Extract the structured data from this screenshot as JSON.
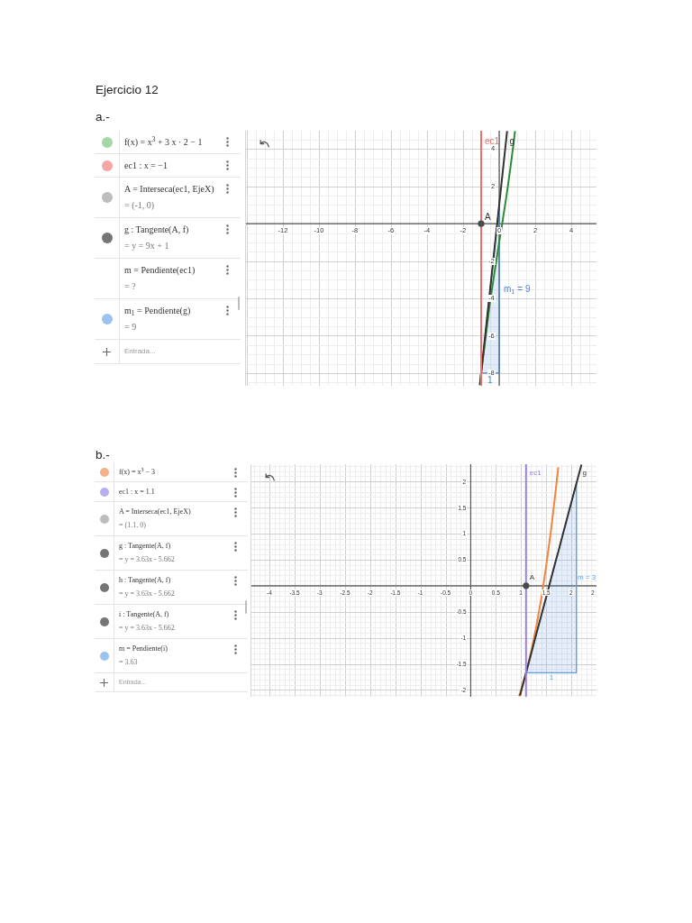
{
  "title": "Ejercicio 12",
  "parts": [
    {
      "label": "a.-",
      "algebra": {
        "rows": [
          {
            "color": "#a5d6a7",
            "definition": "f(x) = x$^{3}$ + 3 x · 2 − 1"
          },
          {
            "color": "#f4a6a6",
            "definition": "ec1 : x = −1"
          },
          {
            "color": "#bdbdbd",
            "definition": "A = Interseca(ec1, EjeX)",
            "value": "= (-1, 0)"
          },
          {
            "color": "#757575",
            "definition": "g : Tangente(A, f)",
            "value": "= y = 9x + 1"
          },
          {
            "definition": "m = Pendiente(ec1)",
            "value": "= ?"
          },
          {
            "color": "#9cc2f0",
            "definition": "m$_{1}$ = Pendiente(g)",
            "value": "= 9"
          }
        ],
        "input": {
          "placeholder": "Entrada..."
        }
      },
      "graph": {
        "chart_data": {
          "type": "line",
          "grid": true,
          "xlim": [
            -14.05,
            5.4
          ],
          "ylim": [
            -8.68,
            4.98
          ],
          "xticks": [
            -12,
            -10,
            -8,
            -6,
            -4,
            -2,
            0,
            2,
            4
          ],
          "yticks": [
            -8,
            -6,
            -4,
            -2,
            2,
            4
          ],
          "x": [
            -1.07,
            -1,
            -1,
            -0.5,
            0,
            0,
            0,
            0.2,
            0.4,
            0.44,
            0.6,
            0.8,
            0.88
          ],
          "series": [
            {
              "color": "#2e8b35",
              "values": [
                -8.65,
                -8,
                -8,
                -4.13,
                -1,
                -1,
                -1,
                0.21,
                1.46,
                1.73,
                2.82,
                4.31,
                4.96
              ]
            },
            {
              "name": "g",
              "color": "#333333",
              "values": [
                -8.63,
                -8,
                -8,
                -3.5,
                1,
                1,
                1,
                2.8,
                4.6,
                4.96,
                null,
                null,
                null
              ]
            },
            {
              "name": "ec1",
              "color": "#ef6f6f",
              "values": [
                null,
                -8.68,
                4.98,
                null,
                null,
                null,
                null,
                null,
                null,
                null,
                null,
                null,
                null
              ]
            },
            {
              "type": "area",
              "color": "#4a86d4",
              "values": [
                null,
                -8,
                -8,
                -8,
                -8,
                -3.5,
                1,
                null,
                null,
                null,
                null,
                null,
                null
              ]
            },
            {
              "name": "A",
              "color": "#4a4a4a",
              "marker": "circle",
              "values": [
                null,
                0,
                null,
                null,
                null,
                null,
                null,
                null,
                null,
                null,
                null,
                null,
                null
              ]
            }
          ],
          "annotations": [
            {
              "text": "1",
              "x": -0.5,
              "y": -8
            },
            {
              "text": "m$_{1}$ = 9",
              "x": 0,
              "y": -3.5
            }
          ]
        }
      }
    },
    {
      "label": "b.-",
      "algebra": {
        "rows": [
          {
            "color": "#f4b08a",
            "definition": "f(x) = x$^{3}$ − 3"
          },
          {
            "color": "#b9adf2",
            "definition": "ec1 : x = 1.1"
          },
          {
            "color": "#bdbdbd",
            "definition": "A = Interseca(ec1, EjeX)",
            "value": "= (1.1, 0)"
          },
          {
            "color": "#757575",
            "definition": "g : Tangente(A, f)",
            "value": "= y = 3.63x - 5.662"
          },
          {
            "color": "#757575",
            "definition": "h : Tangente(A, f)",
            "value": "= y = 3.63x - 5.662"
          },
          {
            "color": "#757575",
            "definition": "i : Tangente(A, f)",
            "value": "= y = 3.63x - 5.662"
          },
          {
            "color": "#9cc2f0",
            "definition": "m = Pendiente(i)",
            "value": "= 3.63"
          }
        ],
        "input": {
          "placeholder": "Entrada..."
        }
      },
      "graph": {
        "chart_data": {
          "type": "line",
          "grid": true,
          "xlim": [
            -4.36,
            2.5
          ],
          "ylim": [
            -2.13,
            2.33
          ],
          "xticks": [
            -4,
            -3.5,
            -3,
            -2.5,
            -2,
            -1.5,
            -1,
            -0.5,
            0,
            0.5,
            1,
            1.5,
            2,
            {
              "value": 2.5,
              "label": "2"
            }
          ],
          "yticks": [
            -2,
            -1.5,
            -1,
            -0.5,
            0.5,
            1,
            1.5,
            2
          ],
          "x": [
            0.96,
            0.98,
            1.1,
            1.1,
            1.2,
            1.3,
            1.4,
            1.5,
            1.6,
            1.7,
            1.74,
            1.8,
            2,
            2.1,
            2.1,
            2.1,
            2.2
          ],
          "series": [
            {
              "color": "#f0843c",
              "values": [
                -2.12,
                -2.06,
                -1.67,
                -1.67,
                -1.27,
                -0.8,
                -0.26,
                0.38,
                1.1,
                1.91,
                2.27,
                null,
                null,
                null,
                null,
                null,
                null
              ]
            },
            {
              "name": "g",
              "color": "#333333",
              "values": [
                null,
                -2.11,
                -1.67,
                -1.67,
                -1.31,
                -0.94,
                -0.58,
                -0.22,
                0.15,
                0.51,
                0.65,
                0.87,
                1.6,
                1.96,
                1.96,
                1.96,
                2.32
              ]
            },
            {
              "name": "ec1",
              "color": "#9b7ff0",
              "values": [
                null,
                null,
                -2.13,
                2.33,
                null,
                null,
                null,
                null,
                null,
                null,
                null,
                null,
                null,
                null,
                null,
                null,
                null
              ]
            },
            {
              "type": "area",
              "color": "#5b9bea",
              "values": [
                null,
                null,
                -1.67,
                -1.67,
                -1.67,
                -1.67,
                -1.67,
                -1.67,
                -1.67,
                -1.67,
                -1.67,
                -1.67,
                -1.67,
                -1.67,
                0.15,
                1.96,
                null
              ]
            },
            {
              "name": "A",
              "color": "#4a4a4a",
              "marker": "circle",
              "values": [
                null,
                null,
                0,
                null,
                null,
                null,
                null,
                null,
                null,
                null,
                null,
                null,
                null,
                null,
                null,
                null,
                null
              ]
            }
          ],
          "annotations": [
            {
              "text": "1",
              "x": 1.6,
              "y": -1.67
            },
            {
              "text": "m = 3",
              "x": 2.1,
              "y": 0.15
            }
          ]
        }
      }
    }
  ]
}
